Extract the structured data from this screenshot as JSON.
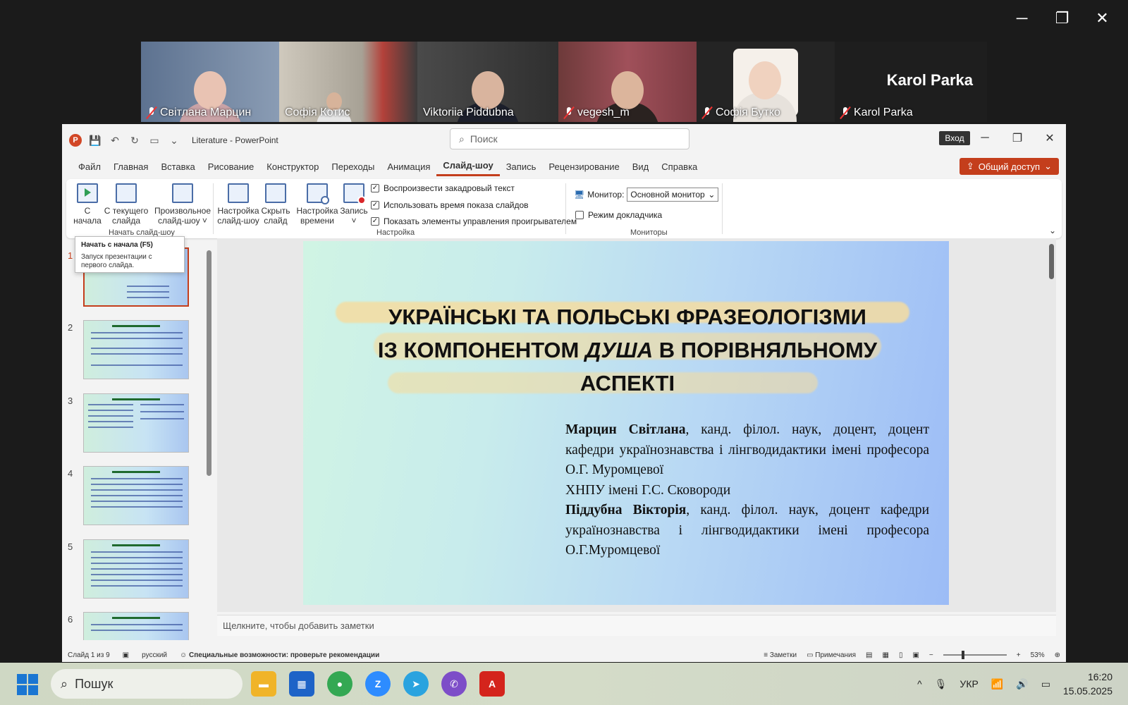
{
  "zoom": {
    "participants": [
      {
        "name": "Світлана Марцин",
        "muted": true,
        "bg": "#7a8ea8",
        "skin": "#e9c3b3",
        "shirt": "#c9a2a6"
      },
      {
        "name": "Софія Котис",
        "muted": false,
        "bg": "#bfb9ad",
        "skin": "#d7b39a",
        "shirt": "#e6e6e6"
      },
      {
        "name": "Viktoriia Piddubna",
        "muted": false,
        "active": true,
        "bg": "#3b3b3b",
        "skin": "#d9b49e",
        "shirt": "#1c1f2b"
      },
      {
        "name": "vegesh_m",
        "muted": true,
        "bg": "#9a4a52",
        "skin": "#dcb59c",
        "shirt": "#2a2220"
      },
      {
        "name": "Софія Бутко",
        "muted": true,
        "bg": "#2a2a2a",
        "skin": "#f0d2bf",
        "shirt": "#e7e2dc"
      },
      {
        "name": "Karol Parka",
        "muted": true,
        "bg": "#1e1e1e",
        "display_name_large": "Karol Parka"
      }
    ]
  },
  "ppt": {
    "app_name": "PowerPoint",
    "file_name": "Literature",
    "title_sep": "-",
    "search_placeholder": "Поиск",
    "login_label": "Вход",
    "share_label": "Общий доступ",
    "tabs": [
      "Файл",
      "Главная",
      "Вставка",
      "Рисование",
      "Конструктор",
      "Переходы",
      "Анимация",
      "Слайд-шоу",
      "Запись",
      "Рецензирование",
      "Вид",
      "Справка"
    ],
    "active_tab": "Слайд-шоу",
    "ribbon": {
      "from_start": [
        "С",
        "начала"
      ],
      "from_current": [
        "С текущего",
        "слайда"
      ],
      "custom": [
        "Произвольное",
        "слайд-шоу ˅"
      ],
      "setup": [
        "Настройка",
        "слайд-шоу"
      ],
      "hide": [
        "Скрыть",
        "слайд"
      ],
      "timing": [
        "Настройка",
        "времени"
      ],
      "record": [
        "Запись",
        "˅"
      ],
      "group_start": "Начать слайд-шоу",
      "group_setup": "Настройка",
      "group_monitors": "Мониторы",
      "checks": [
        {
          "label": "Воспроизвести закадровый текст",
          "checked": true
        },
        {
          "label": "Использовать время показа слайдов",
          "checked": true
        },
        {
          "label": "Показать элементы управления проигрывателем",
          "checked": true
        }
      ],
      "monitor_label": "Монитор:",
      "monitor_value": "Основной монитор",
      "presenter_label": "Режим докладчика",
      "presenter_checked": false
    },
    "tooltip": {
      "title": "Начать с начала (F5)",
      "text": "Запуск презентации с первого слайда."
    },
    "thumbs": [
      {
        "num": "1"
      },
      {
        "num": "2"
      },
      {
        "num": "3"
      },
      {
        "num": "4"
      },
      {
        "num": "5"
      },
      {
        "num": "6"
      }
    ],
    "slide": {
      "title_line1": "УКРАЇНСЬКІ ТА ПОЛЬСЬКІ ФРАЗЕОЛОГІЗМИ",
      "title_line2_a": "ІЗ КОМПОНЕНТОМ ",
      "title_line2_i": "ДУША",
      "title_line2_b": " В ПОРІВНЯЛЬНОМУ",
      "title_line3": "АСПЕКТІ",
      "author1_name": "Марцин Світлана",
      "author1_text": ", канд. філол. наук, доцент, доцент кафедри українознавства і лінгводидактики імені професора О.Г. Муромцевої",
      "affil": "ХНПУ імені Г.С. Сковороди",
      "author2_name": "Піддубна Вікторія",
      "author2_text": ", канд. філол. наук, доцент кафедри українознавства і лінгводидактики імені професора О.Г.Муромцевої"
    },
    "notes_placeholder": "Щелкните, чтобы добавить заметки",
    "status": {
      "slide_of": "Слайд 1 из 9",
      "lang": "русский",
      "accessibility": "Специальные возможности: проверьте рекомендации",
      "notes": "Заметки",
      "comments": "Примечания",
      "zoom": "53%"
    }
  },
  "taskbar": {
    "search_placeholder": "Пошук",
    "lang": "УКР",
    "time": "16:20",
    "date": "15.05.2025",
    "apps": [
      {
        "name": "file-explorer",
        "color": "#f0b429"
      },
      {
        "name": "microsoft-store",
        "color": "#1d63c7"
      },
      {
        "name": "chrome",
        "color": "#34a853"
      },
      {
        "name": "zoom",
        "color": "#2d8cff"
      },
      {
        "name": "telegram",
        "color": "#2aa3df"
      },
      {
        "name": "viber",
        "color": "#7d4dc8"
      },
      {
        "name": "acrobat",
        "color": "#d4241c"
      }
    ]
  }
}
